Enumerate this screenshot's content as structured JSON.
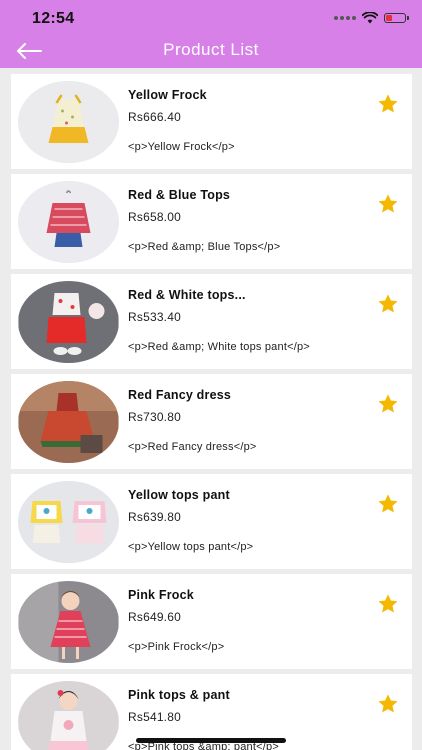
{
  "status_bar": {
    "time": "12:54"
  },
  "header": {
    "title": "Product List",
    "back_icon": "back-arrow-icon"
  },
  "colors": {
    "header_bg": "#d780e8",
    "star": "#f5b800",
    "list_bg": "#ececec"
  },
  "products": [
    {
      "name": "Yellow Frock",
      "price": "Rs666.40",
      "description": "<p>Yellow Frock</p>",
      "icon": "star-icon"
    },
    {
      "name": "Red & Blue Tops",
      "price": "Rs658.00",
      "description": "<p>Red &amp; Blue Tops</p>",
      "icon": "star-icon"
    },
    {
      "name": "Red & White tops...",
      "price": "Rs533.40",
      "description": "<p>Red &amp; White tops pant</p>",
      "icon": "star-icon"
    },
    {
      "name": "Red Fancy dress",
      "price": "Rs730.80",
      "description": "<p>Red Fancy dress</p>",
      "icon": "star-icon"
    },
    {
      "name": "Yellow tops pant",
      "price": "Rs639.80",
      "description": "<p>Yellow tops pant</p>",
      "icon": "star-icon"
    },
    {
      "name": "Pink Frock",
      "price": "Rs649.60",
      "description": "<p>Pink Frock</p>",
      "icon": "star-icon"
    },
    {
      "name": "Pink tops & pant",
      "price": "Rs541.80",
      "description": "<p>Pink tops &amp; pant</p>",
      "icon": "star-icon"
    }
  ]
}
